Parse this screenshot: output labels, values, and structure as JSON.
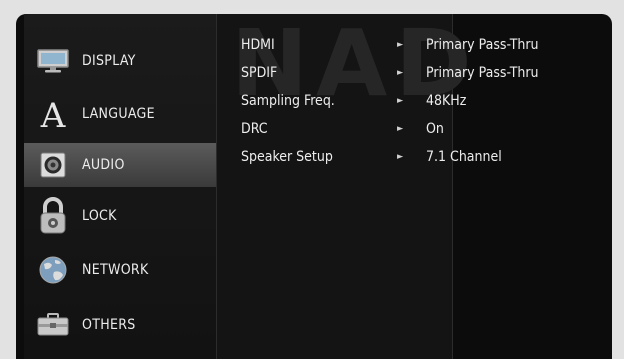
{
  "brand_watermark": "NAD",
  "sidebar": {
    "items": [
      {
        "label": "DISPLAY",
        "icon": "monitor-icon",
        "active": false
      },
      {
        "label": "LANGUAGE",
        "icon": "letter-a-icon",
        "active": false
      },
      {
        "label": "AUDIO",
        "icon": "speaker-icon",
        "active": true
      },
      {
        "label": "LOCK",
        "icon": "padlock-icon",
        "active": false
      },
      {
        "label": "NETWORK",
        "icon": "globe-icon",
        "active": false
      },
      {
        "label": "OTHERS",
        "icon": "toolbox-icon",
        "active": false
      }
    ]
  },
  "settings": [
    {
      "key": "HDMI",
      "value": "Primary Pass-Thru"
    },
    {
      "key": "SPDIF",
      "value": "Primary Pass-Thru"
    },
    {
      "key": "Sampling Freq.",
      "value": "48KHz"
    },
    {
      "key": "DRC",
      "value": "On"
    },
    {
      "key": "Speaker Setup",
      "value": "7.1 Channel"
    }
  ],
  "colors": {
    "background": "#0c0c0c",
    "active_item": "#4a4a4a",
    "text": "#ececec"
  }
}
